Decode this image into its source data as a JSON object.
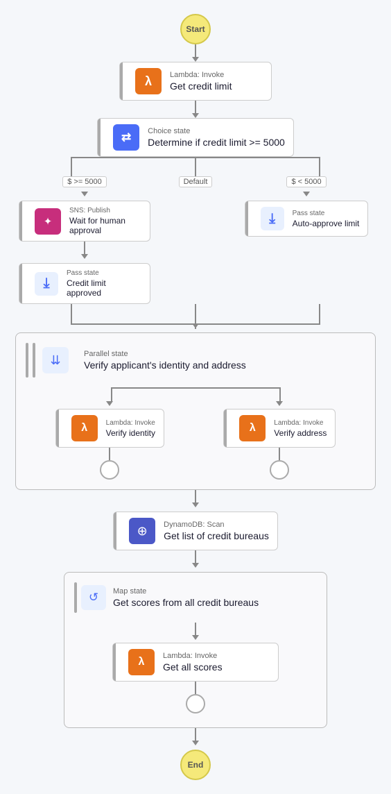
{
  "start_label": "Start",
  "end_label": "End",
  "nodes": {
    "get_credit_limit": {
      "type_label": "Lambda: Invoke",
      "name_label": "Get credit limit",
      "icon_type": "lambda"
    },
    "choice_state": {
      "type_label": "Choice state",
      "name_label": "Determine if credit limit >= 5000",
      "icon_type": "choice"
    },
    "branch_labels": {
      "gte": "$ >= 5000",
      "default": "Default",
      "lt": "$ < 5000"
    },
    "wait_human": {
      "type_label": "SNS: Publish",
      "name_label": "Wait for human approval",
      "icon_type": "sns"
    },
    "pass_approved": {
      "type_label": "Pass state",
      "name_label": "Credit limit approved",
      "icon_type": "pass"
    },
    "pass_auto": {
      "type_label": "Pass state",
      "name_label": "Auto-approve limit",
      "icon_type": "pass"
    },
    "parallel_state": {
      "type_label": "Parallel state",
      "name_label": "Verify applicant's identity and address",
      "icon_type": "parallel"
    },
    "verify_identity": {
      "type_label": "Lambda: Invoke",
      "name_label": "Verify identity",
      "icon_type": "lambda"
    },
    "verify_address": {
      "type_label": "Lambda: Invoke",
      "name_label": "Verify address",
      "icon_type": "lambda"
    },
    "dynamo_scan": {
      "type_label": "DynamoDB: Scan",
      "name_label": "Get list of credit bureaus",
      "icon_type": "dynamo"
    },
    "map_state": {
      "type_label": "Map state",
      "name_label": "Get scores from all credit bureaus",
      "icon_type": "map"
    },
    "get_all_scores": {
      "type_label": "Lambda: Invoke",
      "name_label": "Get all scores",
      "icon_type": "lambda"
    }
  }
}
